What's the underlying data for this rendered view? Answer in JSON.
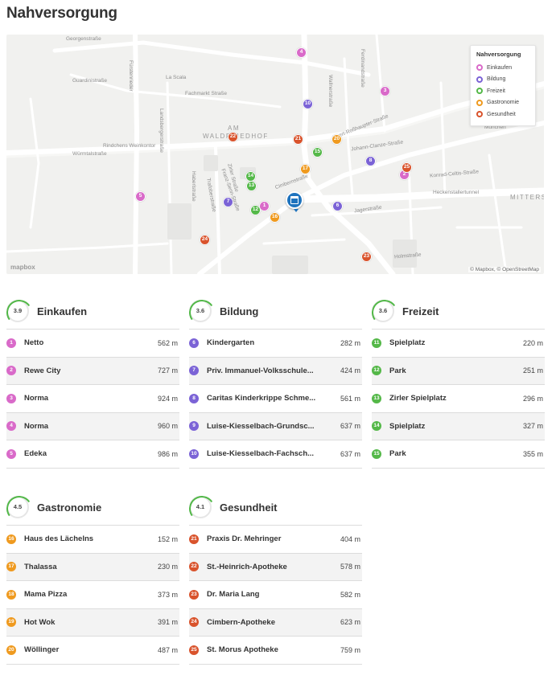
{
  "title": "Nahversorgung",
  "colors": {
    "einkaufen": "#d96ac9",
    "bildung": "#7b63d6",
    "freizeit": "#54b848",
    "gastronomie": "#ef9a1f",
    "gesundheit": "#d9532c",
    "home": "#1e73be"
  },
  "map": {
    "streets": [
      "Georgenstraße",
      "Fürstenrieder",
      "Guardinistraße",
      "La Scala",
      "Fachmarkt Straße",
      "Landsbergerstraße",
      "Rindchens Weinkontor",
      "Würmtalstraße",
      "AM",
      "WALDFRIEDHOF",
      "Johann-Clanze-Straße",
      "Albert-Roßhaupter-Straße",
      "Konrad-Celtis-Straße",
      "Heckenstallertunnel",
      "Jagerstraße",
      "Cimbernstraße",
      "Ferdinandstraße",
      "Wallnerstraße",
      "München",
      "MITTERS",
      "Holmstraße",
      "Haberlstraße",
      "Trafoberstraße",
      "Zirler Straße",
      "Franz-Senn-Straße"
    ],
    "legend": {
      "title": "Nahversorgung",
      "items": [
        "Einkaufen",
        "Bildung",
        "Freizeit",
        "Gastronomie",
        "Gesundheit"
      ],
      "icons": [
        "cart-icon",
        "school-icon",
        "leaf-icon",
        "fork-icon",
        "health-icon"
      ]
    },
    "logo": "mapbox",
    "attribution": "© Mapbox, © OpenStreetMap",
    "markers": [
      "1",
      "2",
      "3",
      "4",
      "5",
      "6",
      "7",
      "8",
      "10",
      "12",
      "13",
      "14",
      "15",
      "16",
      "17",
      "20",
      "21",
      "22",
      "23",
      "24",
      "25"
    ]
  },
  "sections": [
    {
      "key": "einkaufen",
      "score": "3.9",
      "title": "Einkaufen",
      "items": [
        {
          "n": "1",
          "name": "Netto",
          "dist": "562 m"
        },
        {
          "n": "2",
          "name": "Rewe City",
          "dist": "727 m"
        },
        {
          "n": "3",
          "name": "Norma",
          "dist": "924 m"
        },
        {
          "n": "4",
          "name": "Norma",
          "dist": "960 m"
        },
        {
          "n": "5",
          "name": "Edeka",
          "dist": "986 m"
        }
      ]
    },
    {
      "key": "bildung",
      "score": "3.6",
      "title": "Bildung",
      "items": [
        {
          "n": "6",
          "name": "Kindergarten",
          "dist": "282 m"
        },
        {
          "n": "7",
          "name": "Priv. Immanuel-Volksschule...",
          "dist": "424 m"
        },
        {
          "n": "8",
          "name": "Caritas Kinderkrippe Schme...",
          "dist": "561 m"
        },
        {
          "n": "9",
          "name": "Luise-Kiesselbach-Grundsc...",
          "dist": "637 m"
        },
        {
          "n": "10",
          "name": "Luise-Kiesselbach-Fachsch...",
          "dist": "637 m"
        }
      ]
    },
    {
      "key": "freizeit",
      "score": "3.6",
      "title": "Freizeit",
      "items": [
        {
          "n": "11",
          "name": "Spielplatz",
          "dist": "220 m"
        },
        {
          "n": "12",
          "name": "Park",
          "dist": "251 m"
        },
        {
          "n": "13",
          "name": "Zirler Spielplatz",
          "dist": "296 m"
        },
        {
          "n": "14",
          "name": "Spielplatz",
          "dist": "327 m"
        },
        {
          "n": "15",
          "name": "Park",
          "dist": "355 m"
        }
      ]
    },
    {
      "key": "gastronomie",
      "score": "4.5",
      "title": "Gastronomie",
      "items": [
        {
          "n": "16",
          "name": "Haus des Lächelns",
          "dist": "152 m"
        },
        {
          "n": "17",
          "name": "Thalassa",
          "dist": "230 m"
        },
        {
          "n": "18",
          "name": "Mama Pizza",
          "dist": "373 m"
        },
        {
          "n": "19",
          "name": "Hot Wok",
          "dist": "391 m"
        },
        {
          "n": "20",
          "name": "Wöllinger",
          "dist": "487 m"
        }
      ]
    },
    {
      "key": "gesundheit",
      "score": "4.1",
      "title": "Gesundheit",
      "items": [
        {
          "n": "21",
          "name": "Praxis Dr. Mehringer",
          "dist": "404 m"
        },
        {
          "n": "22",
          "name": "St.-Heinrich-Apotheke",
          "dist": "578 m"
        },
        {
          "n": "23",
          "name": "Dr. Maria Lang",
          "dist": "582 m"
        },
        {
          "n": "24",
          "name": "Cimbern-Apotheke",
          "dist": "623 m"
        },
        {
          "n": "25",
          "name": "St. Morus Apotheke",
          "dist": "759 m"
        }
      ]
    }
  ]
}
